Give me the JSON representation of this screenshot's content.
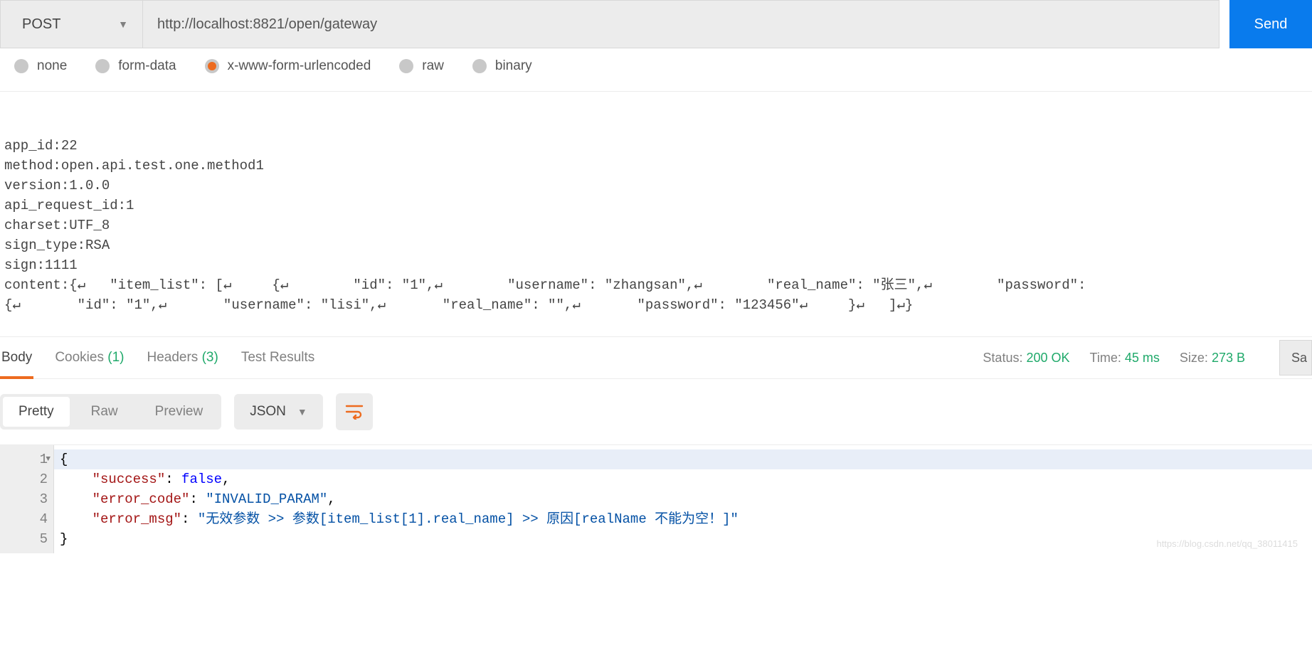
{
  "request": {
    "method": "POST",
    "url": "http://localhost:8821/open/gateway",
    "send_label": "Send"
  },
  "body_type_options": {
    "none": "none",
    "form_data": "form-data",
    "urlencoded": "x-www-form-urlencoded",
    "raw": "raw",
    "binary": "binary"
  },
  "body_type_selected": "urlencoded",
  "request_body_text": "app_id:22\nmethod:open.api.test.one.method1\nversion:1.0.0\napi_request_id:1\ncharset:UTF_8\nsign_type:RSA\nsign:1111\ncontent:{↵   \"item_list\": [↵     {↵        \"id\": \"1\",↵        \"username\": \"zhangsan\",↵        \"real_name\": \"张三\",↵        \"password\":\n{↵       \"id\": \"1\",↵       \"username\": \"lisi\",↵       \"real_name\": \"\",↵       \"password\": \"123456\"↵     }↵   ]↵}",
  "response_tabs": {
    "body": "Body",
    "cookies": "Cookies",
    "cookies_count": "(1)",
    "headers": "Headers",
    "headers_count": "(3)",
    "tests": "Test Results"
  },
  "response_meta": {
    "status_label": "Status:",
    "status_value": "200 OK",
    "time_label": "Time:",
    "time_value": "45 ms",
    "size_label": "Size:",
    "size_value": "273 B",
    "save_trunc": "Sa"
  },
  "viewer": {
    "pretty": "Pretty",
    "raw": "Raw",
    "preview": "Preview",
    "format": "JSON"
  },
  "response_json": {
    "lines": [
      "1",
      "2",
      "3",
      "4",
      "5"
    ],
    "content": {
      "open": "{",
      "l2_key": "\"success\"",
      "l2_val": "false",
      "l3_key": "\"error_code\"",
      "l3_val": "\"INVALID_PARAM\"",
      "l4_key": "\"error_msg\"",
      "l4_val": "\"无效参数 >> 参数[item_list[1].real_name] >> 原因[realName 不能为空！]\"",
      "close": "}"
    }
  },
  "watermark": "https://blog.csdn.net/qq_38011415"
}
